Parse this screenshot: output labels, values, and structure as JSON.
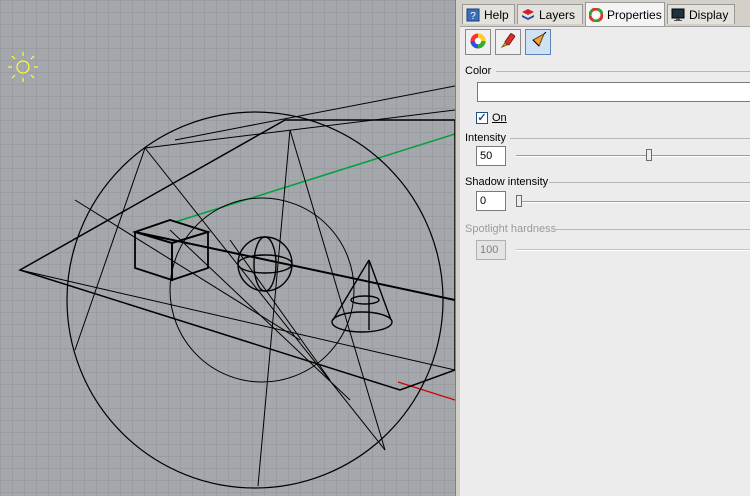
{
  "tabs": [
    {
      "label": "Help",
      "icon": "help-icon",
      "active": false
    },
    {
      "label": "Layers",
      "icon": "layers-icon",
      "active": false
    },
    {
      "label": "Properties",
      "icon": "properties-color-wheel-icon",
      "active": true
    },
    {
      "label": "Display",
      "icon": "display-monitor-icon",
      "active": false
    }
  ],
  "toolbar": {
    "buttons": [
      {
        "icon": "color-wheel-icon"
      },
      {
        "icon": "brush-icon"
      },
      {
        "icon": "spotlight-icon",
        "selected": true
      }
    ]
  },
  "properties": {
    "color_label": "Color",
    "color_value": "#ffffff",
    "on_label": "On",
    "on_checked": true,
    "intensity_label": "Intensity",
    "intensity_value": "50",
    "intensity_slider": 0.54,
    "shadow_label": "Shadow intensity",
    "shadow_value": "0",
    "shadow_slider": 0.0,
    "hardness_label": "Spotlight hardness",
    "hardness_value": "100",
    "hardness_slider": 0.0,
    "hardness_enabled": false
  },
  "viewport": {
    "light_icon": "sun-light-icon",
    "grid_color": "#999ca0",
    "background_color": "#a4a7ab"
  }
}
